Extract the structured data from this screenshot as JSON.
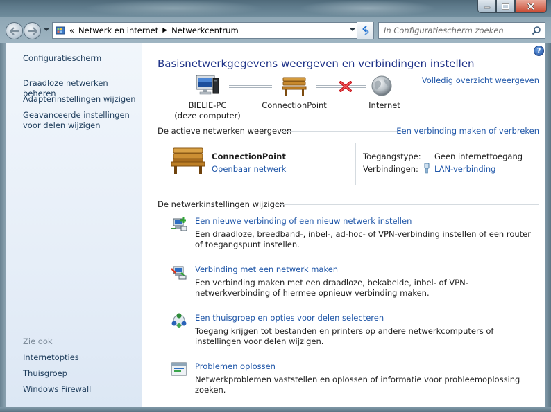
{
  "titlebar": {
    "minimize_label": "minimize",
    "maximize_label": "maximize",
    "close_label": "close"
  },
  "address": {
    "prefix": "«",
    "crumbs": [
      "Netwerk en internet",
      "Netwerkcentrum"
    ],
    "separator": "▶"
  },
  "search": {
    "placeholder": "In Configuratiescherm zoeken"
  },
  "sidebar": {
    "home": "Configuratiescherm",
    "items": [
      "Draadloze netwerken beheren",
      "Adapterinstellingen wijzigen",
      "Geavanceerde instellingen voor delen wijzigen"
    ],
    "see_also_title": "Zie ook",
    "see_also": [
      "Internetopties",
      "Thuisgroep",
      "Windows Firewall"
    ]
  },
  "main": {
    "help": "?",
    "heading": "Basisnetwerkgegevens weergeven en verbindingen instellen",
    "full_map_link": "Volledig overzicht weergeven",
    "map": {
      "pc_name": "BIELIE-PC",
      "pc_sub": "(deze computer)",
      "network_name": "ConnectionPoint",
      "internet": "Internet",
      "connection_status": "broken"
    },
    "active": {
      "title": "De actieve netwerken weergeven",
      "link": "Een verbinding maken of verbreken",
      "network_name": "ConnectionPoint",
      "network_type": "Openbaar netwerk",
      "access_type_label": "Toegangstype:",
      "access_type_value": "Geen internettoegang",
      "connections_label": "Verbindingen:",
      "connections_value": "LAN-verbinding"
    },
    "change": {
      "title": "De netwerkinstellingen wijzigen",
      "tasks": [
        {
          "icon": "new-connection-icon",
          "link": "Een nieuwe verbinding of een nieuw netwerk instellen",
          "desc": "Een draadloze, breedband-, inbel-, ad-hoc- of VPN-verbinding instellen of een router of toegangspunt instellen."
        },
        {
          "icon": "connect-network-icon",
          "link": "Verbinding met een netwerk maken",
          "desc": "Een verbinding maken met een draadloze, bekabelde, inbel- of VPN-netwerkverbinding of hiermee opnieuw verbinding maken."
        },
        {
          "icon": "homegroup-icon",
          "link": "Een thuisgroep en opties voor delen selecteren",
          "desc": "Toegang krijgen tot bestanden en printers op andere netwerkcomputers of instellingen voor delen wijzigen."
        },
        {
          "icon": "troubleshoot-icon",
          "link": "Problemen oplossen",
          "desc": "Netwerkproblemen vaststellen en oplossen of informatie voor probleemoplossing zoeken."
        }
      ]
    }
  },
  "colors": {
    "link": "#1f56a8",
    "heading": "#1e3287",
    "sidebar_link": "#1c3b5a",
    "sidebar_bg": "#e6eef8"
  }
}
